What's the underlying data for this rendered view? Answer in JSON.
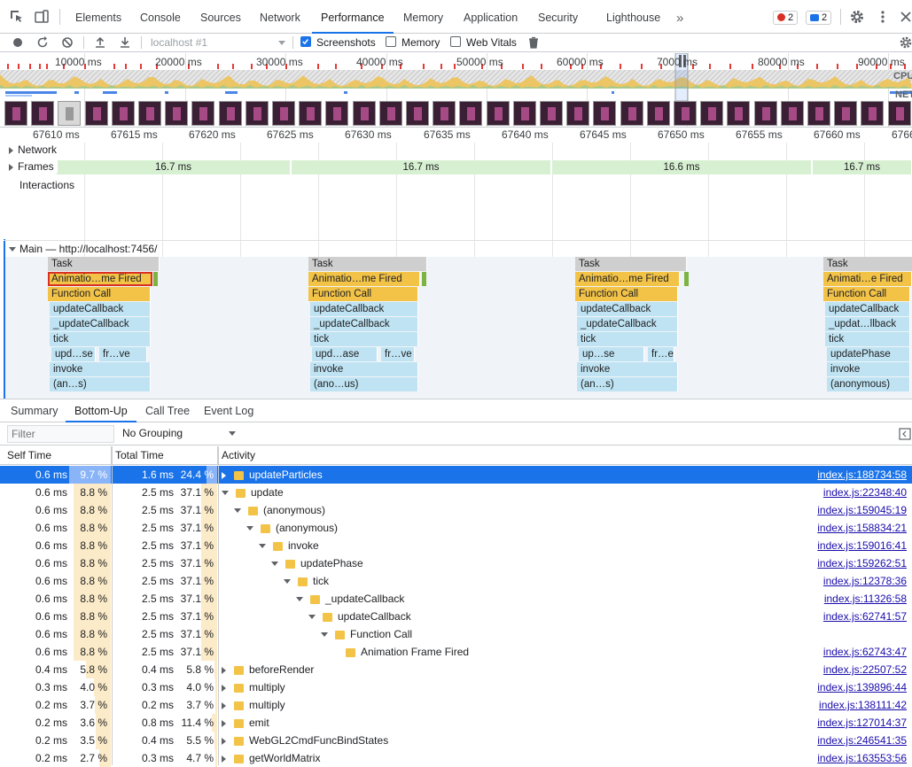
{
  "tabs": [
    "Elements",
    "Console",
    "Sources",
    "Network",
    "Performance",
    "Memory",
    "Application",
    "Security",
    "Lighthouse"
  ],
  "active_tab": "Performance",
  "more_tabs": "»",
  "badges": {
    "errors": "2",
    "messages": "2"
  },
  "toolbar": {
    "target": "localhost #1",
    "screenshots_label": "Screenshots",
    "memory_label": "Memory",
    "web_vitals_label": "Web Vitals"
  },
  "overview": {
    "ticks": [
      "10000 ms",
      "20000 ms",
      "30000 ms",
      "40000 ms",
      "50000 ms",
      "60000 ms",
      "7000 ms",
      "80000 ms",
      "90000 ms"
    ],
    "cpu_label": "CPU",
    "net_label": "NET"
  },
  "ruler": [
    "67610 ms",
    "67615 ms",
    "67620 ms",
    "67625 ms",
    "67630 ms",
    "67635 ms",
    "67640 ms",
    "67645 ms",
    "67650 ms",
    "67655 ms",
    "67660 ms",
    "6766"
  ],
  "tracks": {
    "network": "Network",
    "frames": "Frames",
    "interactions": "Interactions",
    "main": "Main — http://localhost:7456/"
  },
  "frames": [
    "16.7 ms",
    "16.7 ms",
    "16.6 ms",
    "16.7 ms"
  ],
  "flame": {
    "col1": [
      "Task",
      "Animatio…me Fired",
      "Function Call",
      "updateCallback",
      "_updateCallback",
      "tick",
      "upd…se",
      "fr…ve",
      "invoke",
      "(an…s)"
    ],
    "col2": [
      "Task",
      "Animatio…me Fired",
      "Function Call",
      "updateCallback",
      "_updateCallback",
      "tick",
      "upd…ase",
      "fr…ve",
      "invoke",
      "(ano…us)"
    ],
    "col3": [
      "Task",
      "Animatio…me Fired",
      "Function Call",
      "updateCallback",
      "_updateCallback",
      "tick",
      "up…se",
      "fr…e",
      "invoke",
      "(an…s)"
    ],
    "col4": [
      "Task",
      "Animati…e Fired",
      "Function Call",
      "updateCallback",
      "_updat…llback",
      "tick",
      "updatePhase",
      "invoke",
      "(anonymous)"
    ]
  },
  "bottom_tabs": [
    "Summary",
    "Bottom-Up",
    "Call Tree",
    "Event Log"
  ],
  "active_bottom_tab": "Bottom-Up",
  "filter": {
    "placeholder": "Filter",
    "grouping": "No Grouping"
  },
  "columns": {
    "self": "Self Time",
    "total": "Total Time",
    "activity": "Activity"
  },
  "rows": [
    {
      "self_ms": "0.6 ms",
      "self_pct": "9.7 %",
      "self_frac": 0.097,
      "total_ms": "1.6 ms",
      "total_pct": "24.4 %",
      "total_frac": 0.244,
      "name": "updateParticles",
      "link": "index.js:188734:58",
      "depth": 0,
      "arrow": "right",
      "selected": true
    },
    {
      "self_ms": "0.6 ms",
      "self_pct": "8.8 %",
      "self_frac": 0.088,
      "total_ms": "2.5 ms",
      "total_pct": "37.1 %",
      "total_frac": 0.371,
      "name": "update",
      "link": "index.js:22348:40",
      "depth": 0,
      "arrow": "down"
    },
    {
      "self_ms": "0.6 ms",
      "self_pct": "8.8 %",
      "self_frac": 0.088,
      "total_ms": "2.5 ms",
      "total_pct": "37.1 %",
      "total_frac": 0.371,
      "name": "(anonymous)",
      "link": "index.js:159045:19",
      "depth": 1,
      "arrow": "down"
    },
    {
      "self_ms": "0.6 ms",
      "self_pct": "8.8 %",
      "self_frac": 0.088,
      "total_ms": "2.5 ms",
      "total_pct": "37.1 %",
      "total_frac": 0.371,
      "name": "(anonymous)",
      "link": "index.js:158834:21",
      "depth": 2,
      "arrow": "down"
    },
    {
      "self_ms": "0.6 ms",
      "self_pct": "8.8 %",
      "self_frac": 0.088,
      "total_ms": "2.5 ms",
      "total_pct": "37.1 %",
      "total_frac": 0.371,
      "name": "invoke",
      "link": "index.js:159016:41",
      "depth": 3,
      "arrow": "down"
    },
    {
      "self_ms": "0.6 ms",
      "self_pct": "8.8 %",
      "self_frac": 0.088,
      "total_ms": "2.5 ms",
      "total_pct": "37.1 %",
      "total_frac": 0.371,
      "name": "updatePhase",
      "link": "index.js:159262:51",
      "depth": 4,
      "arrow": "down"
    },
    {
      "self_ms": "0.6 ms",
      "self_pct": "8.8 %",
      "self_frac": 0.088,
      "total_ms": "2.5 ms",
      "total_pct": "37.1 %",
      "total_frac": 0.371,
      "name": "tick",
      "link": "index.js:12378:36",
      "depth": 5,
      "arrow": "down"
    },
    {
      "self_ms": "0.6 ms",
      "self_pct": "8.8 %",
      "self_frac": 0.088,
      "total_ms": "2.5 ms",
      "total_pct": "37.1 %",
      "total_frac": 0.371,
      "name": "_updateCallback",
      "link": "index.js:11326:58",
      "depth": 6,
      "arrow": "down"
    },
    {
      "self_ms": "0.6 ms",
      "self_pct": "8.8 %",
      "self_frac": 0.088,
      "total_ms": "2.5 ms",
      "total_pct": "37.1 %",
      "total_frac": 0.371,
      "name": "updateCallback",
      "link": "index.js:62741:57",
      "depth": 7,
      "arrow": "down"
    },
    {
      "self_ms": "0.6 ms",
      "self_pct": "8.8 %",
      "self_frac": 0.088,
      "total_ms": "2.5 ms",
      "total_pct": "37.1 %",
      "total_frac": 0.371,
      "name": "Function Call",
      "link": "",
      "depth": 8,
      "arrow": "down"
    },
    {
      "self_ms": "0.6 ms",
      "self_pct": "8.8 %",
      "self_frac": 0.088,
      "total_ms": "2.5 ms",
      "total_pct": "37.1 %",
      "total_frac": 0.371,
      "name": "Animation Frame Fired",
      "link": "index.js:62743:47",
      "depth": 9,
      "arrow": "none"
    },
    {
      "self_ms": "0.4 ms",
      "self_pct": "5.8 %",
      "self_frac": 0.058,
      "total_ms": "0.4 ms",
      "total_pct": "5.8 %",
      "total_frac": 0.058,
      "name": "beforeRender",
      "link": "index.js:22507:52",
      "depth": 0,
      "arrow": "right"
    },
    {
      "self_ms": "0.3 ms",
      "self_pct": "4.0 %",
      "self_frac": 0.04,
      "total_ms": "0.3 ms",
      "total_pct": "4.0 %",
      "total_frac": 0.04,
      "name": "multiply",
      "link": "index.js:139896:44",
      "depth": 0,
      "arrow": "right"
    },
    {
      "self_ms": "0.2 ms",
      "self_pct": "3.7 %",
      "self_frac": 0.037,
      "total_ms": "0.2 ms",
      "total_pct": "3.7 %",
      "total_frac": 0.037,
      "name": "multiply",
      "link": "index.js:138111:42",
      "depth": 0,
      "arrow": "right"
    },
    {
      "self_ms": "0.2 ms",
      "self_pct": "3.6 %",
      "self_frac": 0.036,
      "total_ms": "0.8 ms",
      "total_pct": "11.4 %",
      "total_frac": 0.114,
      "name": "emit",
      "link": "index.js:127014:37",
      "depth": 0,
      "arrow": "right"
    },
    {
      "self_ms": "0.2 ms",
      "self_pct": "3.5 %",
      "self_frac": 0.035,
      "total_ms": "0.4 ms",
      "total_pct": "5.5 %",
      "total_frac": 0.055,
      "name": "WebGL2CmdFuncBindStates",
      "link": "index.js:246541:35",
      "depth": 0,
      "arrow": "right"
    },
    {
      "self_ms": "0.2 ms",
      "self_pct": "2.7 %",
      "self_frac": 0.027,
      "total_ms": "0.3 ms",
      "total_pct": "4.7 %",
      "total_frac": 0.047,
      "name": "getWorldMatrix",
      "link": "index.js:163553:56",
      "depth": 0,
      "arrow": "right"
    }
  ]
}
